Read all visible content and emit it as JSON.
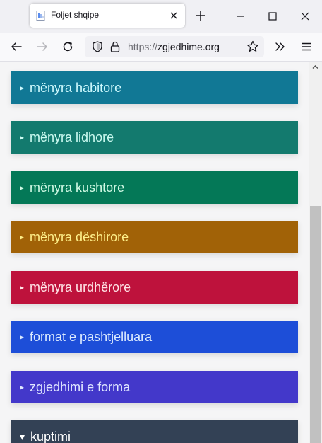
{
  "browser": {
    "tab": {
      "title": "Foljet shqipe"
    },
    "url": {
      "scheme": "https://",
      "host": "zgjedhime.org"
    }
  },
  "sections": [
    {
      "label": "mënyra habitore",
      "arrow": "▸",
      "bg": "#117895",
      "fg": "#cffafe"
    },
    {
      "label": "mënyra lidhore",
      "arrow": "▸",
      "bg": "#137a6e",
      "fg": "#ccfbf1"
    },
    {
      "label": "mënyra kushtore",
      "arrow": "▸",
      "bg": "#047857",
      "fg": "#d1fae5"
    },
    {
      "label": "mënyra dëshirore",
      "arrow": "▸",
      "bg": "#a16207",
      "fg": "#fef08a"
    },
    {
      "label": "mënyra urdhërore",
      "arrow": "▸",
      "bg": "#be123c",
      "fg": "#ffe4e6"
    },
    {
      "label": "format e pashtjelluara",
      "arrow": "▸",
      "bg": "#1d4ed8",
      "fg": "#dbeafe"
    },
    {
      "label": "zgjedhimi e forma",
      "arrow": "▸",
      "bg": "#4338ca",
      "fg": "#e0e7ff"
    },
    {
      "label": "kuptimi",
      "arrow": "▾",
      "bg": "#334155",
      "fg": "#ffffff"
    }
  ]
}
